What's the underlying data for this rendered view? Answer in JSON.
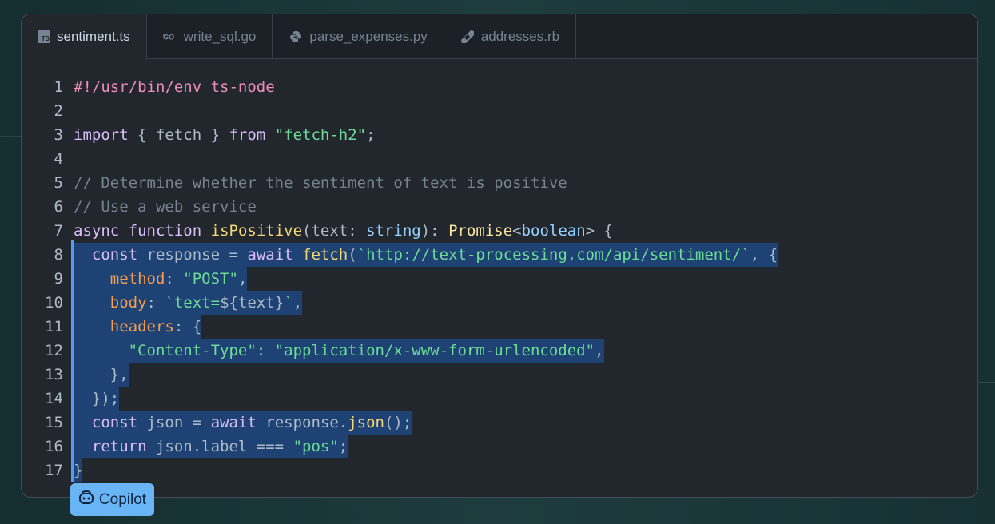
{
  "tabs": [
    {
      "label": "sentiment.ts",
      "icon": "typescript-icon",
      "active": true
    },
    {
      "label": "write_sql.go",
      "icon": "go-icon",
      "active": false
    },
    {
      "label": "parse_expenses.py",
      "icon": "python-icon",
      "active": false
    },
    {
      "label": "addresses.rb",
      "icon": "ruby-icon",
      "active": false
    }
  ],
  "line_numbers": [
    "1",
    "2",
    "3",
    "4",
    "5",
    "6",
    "7",
    "8",
    "9",
    "10",
    "11",
    "12",
    "13",
    "14",
    "15",
    "16",
    "17"
  ],
  "code": {
    "l1": "#!/usr/bin/env ts-node",
    "l3": {
      "a": "import",
      "b": " { fetch } ",
      "c": "from",
      "d": " ",
      "e": "\"fetch-h2\"",
      "f": ";"
    },
    "l5": "// Determine whether the sentiment of text is positive",
    "l6": "// Use a web service",
    "l7": {
      "a": "async",
      "b": " ",
      "c": "function",
      "d": " ",
      "e": "isPositive",
      "f": "(text: ",
      "g": "string",
      "h": "): ",
      "i": "Promise",
      "j": "<",
      "k": "boolean",
      "l": "> {"
    },
    "l8": {
      "a": "  ",
      "b": "const",
      "c": " response = ",
      "d": "await",
      "e": " ",
      "f": "fetch",
      "g": "(",
      "h": "`http://text-processing.com/api/sentiment/`",
      "i": ", {"
    },
    "l9": {
      "a": "    ",
      "b": "method",
      "c": ": ",
      "d": "\"POST\"",
      "e": ","
    },
    "l10": {
      "a": "    ",
      "b": "body",
      "c": ": ",
      "d": "`text=",
      "e": "${text}",
      "f": "`",
      "g": ","
    },
    "l11": {
      "a": "    ",
      "b": "headers",
      "c": ": {"
    },
    "l12": {
      "a": "      ",
      "b": "\"Content-Type\"",
      "c": ": ",
      "d": "\"application/x-www-form-urlencoded\"",
      "e": ","
    },
    "l13": "    },",
    "l14": "  });",
    "l15": {
      "a": "  ",
      "b": "const",
      "c": " json = ",
      "d": "await",
      "e": " response.",
      "f": "json",
      "g": "();"
    },
    "l16": {
      "a": "  ",
      "b": "return",
      "c": " json.label === ",
      "d": "\"pos\"",
      "e": ";"
    },
    "l17": "}"
  },
  "copilot": {
    "label": "Copilot",
    "icon": "copilot-icon"
  },
  "colors": {
    "keyword": "#dcbdfb",
    "string": "#6cdb96",
    "function": "#f5d774",
    "comment": "#768390",
    "selection": "#1e4273",
    "badge": "#69b4f4"
  }
}
